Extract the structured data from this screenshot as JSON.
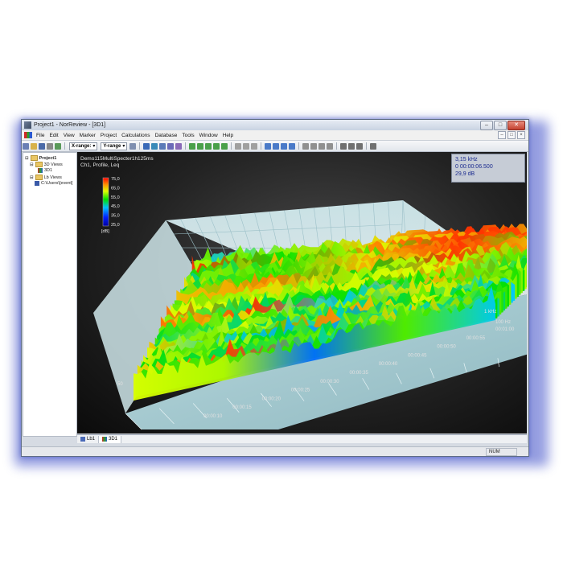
{
  "window": {
    "title": "Project1 - NorReview - [3D1]"
  },
  "menu": [
    "File",
    "Edit",
    "View",
    "Marker",
    "Project",
    "Calculations",
    "Database",
    "Tools",
    "Window",
    "Help"
  ],
  "toolbar": {
    "x_range_label": "X-range:",
    "y_range_label": "Y-range"
  },
  "tree": {
    "root": "Project1",
    "views_3d": "3D Views",
    "view_3d1": "3D1",
    "views_lb": "Lb Views",
    "path": "C:\\Users\\[event]"
  },
  "plot": {
    "file": "Demo115MultiSpecter1h125ms",
    "subtitle": "Ch1, Profile, Leq",
    "readout": {
      "freq": "3,15 kHz",
      "time": "0 00:00:06.500",
      "level": "29,9 dB"
    },
    "colorbar": {
      "ticks": [
        "75,0",
        "65,0",
        "55,0",
        "45,0",
        "35,0",
        "25,0"
      ],
      "unit": "[dB]"
    },
    "z_tick": "50",
    "time_ticks": [
      "00:00:10",
      "00:00:15",
      "00:00:20",
      "00:00:25",
      "00:00:30",
      "00:00:35",
      "00:00:40",
      "00:00:45",
      "00:00:50",
      "00:00:55",
      "00:01:00"
    ],
    "freq_tick": "100 Hz",
    "freq_tick2": "1 kHz",
    "colors": {
      "low": "#0000c8",
      "mid": "#00d000",
      "high": "#ff0000"
    }
  },
  "doc_tabs": [
    "Lb1",
    "3D1"
  ],
  "status": {
    "num": "NUM"
  }
}
